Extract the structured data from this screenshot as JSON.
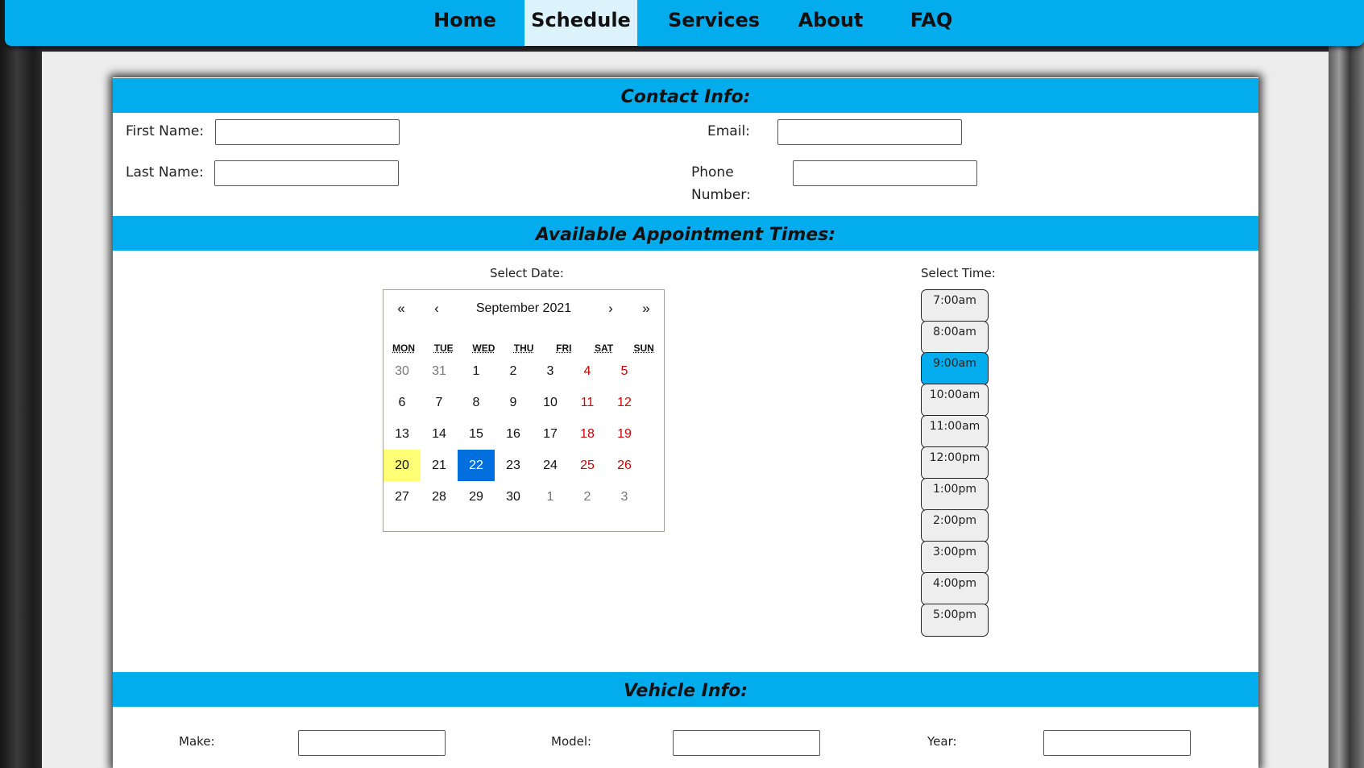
{
  "nav": {
    "items": [
      {
        "label": "Home"
      },
      {
        "label": "Schedule"
      },
      {
        "label": "Services"
      },
      {
        "label": "About"
      },
      {
        "label": "FAQ"
      }
    ],
    "active": "Schedule"
  },
  "contact": {
    "heading": "Contact Info:",
    "first_name_label": "First Name:",
    "last_name_label": "Last Name:",
    "email_label": "Email:",
    "phone_label_line1": "Phone",
    "phone_label_line2": "Number:",
    "first_name_value": "",
    "last_name_value": "",
    "email_value": "",
    "phone_value": ""
  },
  "appointment": {
    "heading": "Available Appointment Times:",
    "select_date_label": "Select Date:",
    "select_time_label": "Select Time:",
    "calendar": {
      "prev_year": "«",
      "prev_month": "‹",
      "title": "September 2021",
      "next_month": "›",
      "next_year": "»",
      "weekdays": [
        "MON",
        "TUE",
        "WED",
        "THU",
        "FRI",
        "SAT",
        "SUN"
      ],
      "weeks": [
        [
          "30",
          "31",
          "1",
          "2",
          "3",
          "4",
          "5"
        ],
        [
          "6",
          "7",
          "8",
          "9",
          "10",
          "11",
          "12"
        ],
        [
          "13",
          "14",
          "15",
          "16",
          "17",
          "18",
          "19"
        ],
        [
          "20",
          "21",
          "22",
          "23",
          "24",
          "25",
          "26"
        ],
        [
          "27",
          "28",
          "29",
          "30",
          "1",
          "2",
          "3"
        ]
      ],
      "today": "20",
      "selected": "22"
    },
    "times": [
      "7:00am",
      "8:00am",
      "9:00am",
      "10:00am",
      "11:00am",
      "12:00pm",
      "1:00pm",
      "2:00pm",
      "3:00pm",
      "4:00pm",
      "5:00pm"
    ],
    "selected_time": "9:00am"
  },
  "vehicle": {
    "heading": "Vehicle Info:",
    "make_label": "Make:",
    "model_label": "Model:",
    "year_label": "Year:",
    "make_value": "",
    "model_value": "",
    "year_value": ""
  },
  "colors": {
    "accent": "#03aced",
    "today_highlight": "#ffff76",
    "selected_date": "#006edc",
    "weekend_text": "#d10000"
  }
}
